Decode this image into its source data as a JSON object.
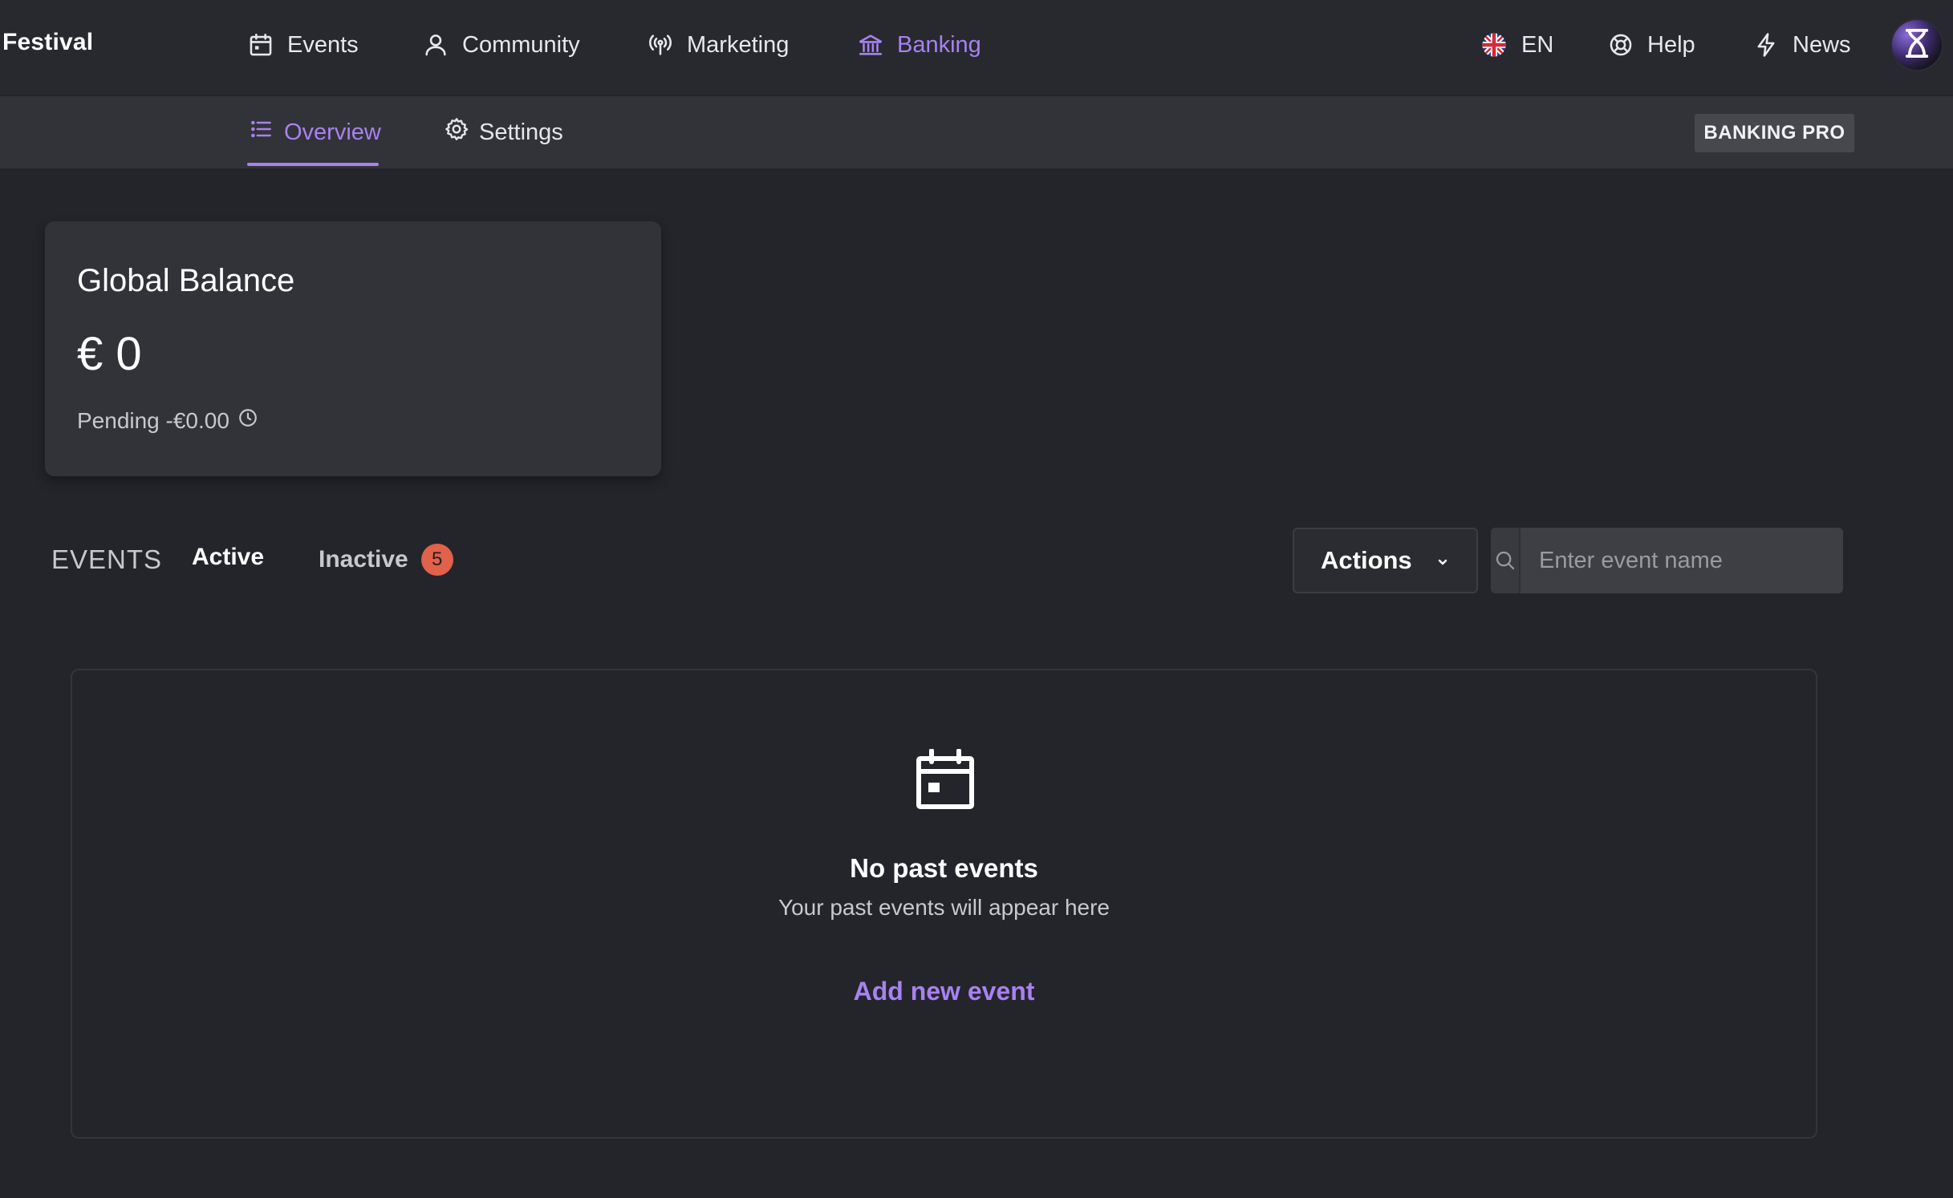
{
  "topnav": {
    "brand": "Festival",
    "items": [
      {
        "label": "Events",
        "icon": "calendar-icon"
      },
      {
        "label": "Community",
        "icon": "user-icon"
      },
      {
        "label": "Marketing",
        "icon": "broadcast-icon"
      },
      {
        "label": "Banking",
        "icon": "bank-icon",
        "active": true
      }
    ],
    "right": {
      "language": "EN",
      "language_icon": "uk-flag-icon",
      "help": "Help",
      "help_icon": "lifebuoy-icon",
      "news": "News",
      "news_icon": "lightning-icon",
      "avatar_icon": "hourglass-icon"
    }
  },
  "subnav": {
    "tabs": [
      {
        "label": "Overview",
        "icon": "list-icon",
        "active": true
      },
      {
        "label": "Settings",
        "icon": "gear-icon"
      }
    ],
    "plan_badge": "BANKING PRO"
  },
  "balance": {
    "title": "Global Balance",
    "amount": "€ 0",
    "pending": "Pending -€0.00",
    "pending_icon": "clock-icon"
  },
  "events": {
    "section_label": "EVENTS",
    "tabs": {
      "active": "Active",
      "inactive": "Inactive",
      "inactive_count": "5"
    },
    "actions_label": "Actions",
    "search": {
      "placeholder": "Enter event name",
      "value": ""
    }
  },
  "empty_state": {
    "icon": "calendar-icon",
    "title": "No past events",
    "subtitle": "Your past events will appear here",
    "cta": "Add new event"
  },
  "colors": {
    "accent": "#a981f0",
    "background": "#23252b",
    "topbar": "#27292f",
    "subbar": "#323338",
    "card": "#323338",
    "badge": "#e2614a"
  }
}
